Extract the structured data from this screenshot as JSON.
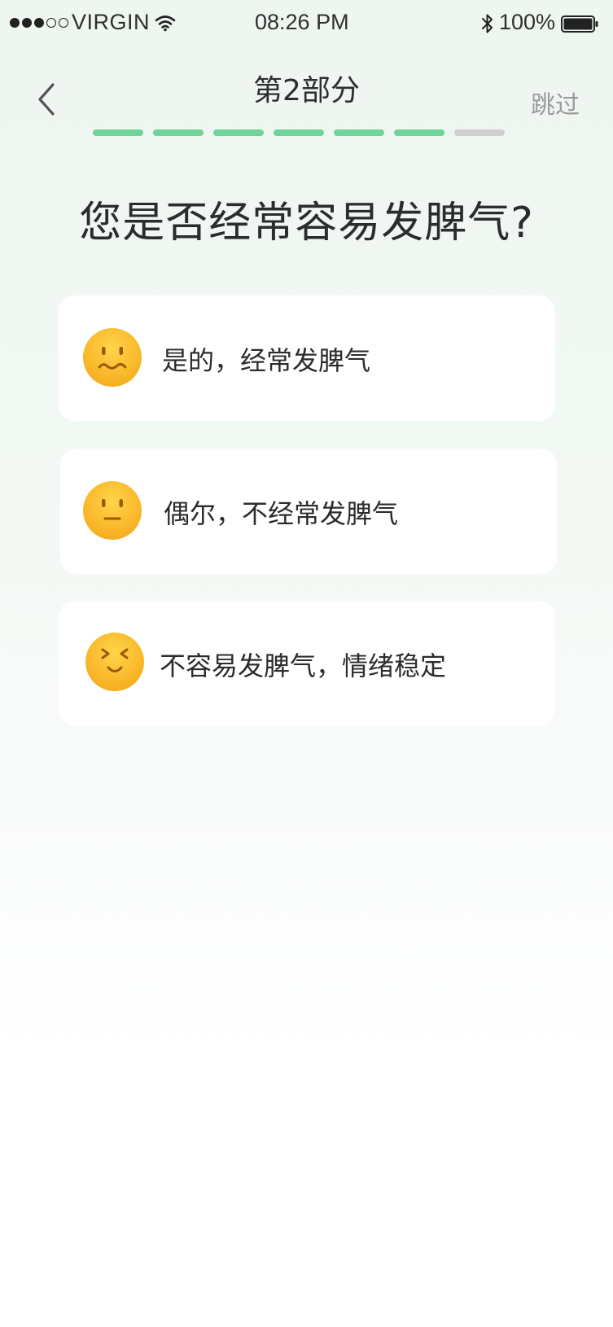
{
  "status_bar": {
    "carrier": "VIRGIN",
    "time": "08:26 PM",
    "battery": "100%",
    "signal_bars_filled": 3,
    "signal_bars_total": 5
  },
  "header": {
    "title": "第2部分",
    "skip_label": "跳过",
    "back_icon": "chevron-left-icon"
  },
  "progress": {
    "completed": 6,
    "total": 7,
    "active_color": "#6fd49a",
    "inactive_color": "#cfcfcf"
  },
  "question": "您是否经常容易发脾气?",
  "options": [
    {
      "label": "是的，经常发脾气",
      "icon": "worried-face-icon"
    },
    {
      "label": "偶尔，不经常发脾气",
      "icon": "neutral-face-icon"
    },
    {
      "label": "不容易发脾气，情绪稳定",
      "icon": "happy-face-icon"
    }
  ],
  "colors": {
    "emoji_yellow": "#fbbf2c",
    "emoji_feature": "#9c5a0a"
  }
}
